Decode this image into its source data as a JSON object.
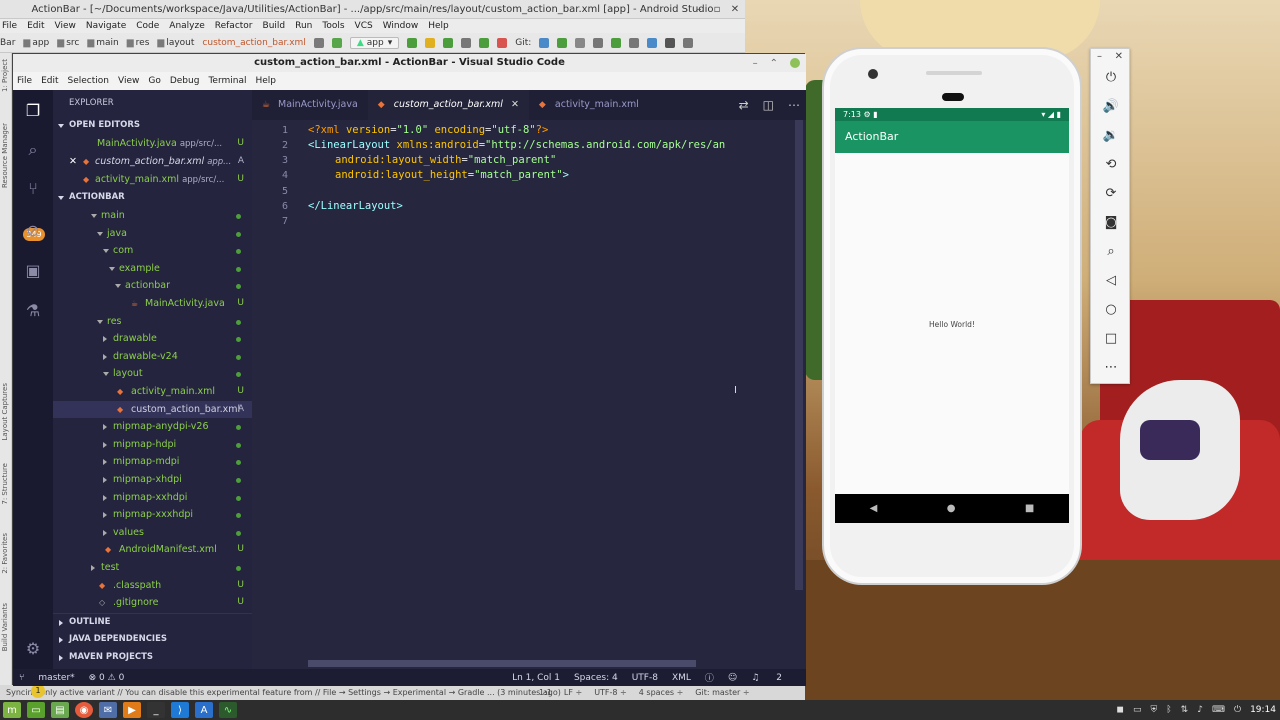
{
  "android_studio": {
    "title": "ActionBar - [~/Documents/workspace/Java/Utilities/ActionBar] - .../app/src/main/res/layout/custom_action_bar.xml [app] - Android Studio",
    "menu": [
      "File",
      "Edit",
      "View",
      "Navigate",
      "Code",
      "Analyze",
      "Refactor",
      "Build",
      "Run",
      "Tools",
      "VCS",
      "Window",
      "Help"
    ],
    "breadcrumbs": [
      "Bar",
      "app",
      "src",
      "main",
      "res",
      "layout",
      "custom_action_bar.xml"
    ],
    "run_config": "app",
    "git_label": "Git:",
    "left_tabs": [
      "1: Project",
      "Resource Manager",
      "Layout Captures",
      "7: Structure",
      "2: Favorites",
      "Build Variants"
    ],
    "status_message": "Syncing only active variant // You can disable this experimental feature from // File → Settings → Experimental → Gradle ... (3 minutes ago)",
    "status_right": [
      "1:1",
      "LF ÷",
      "UTF-8 ÷",
      "4 spaces ÷",
      "Git: master ÷"
    ]
  },
  "vscode": {
    "title": "custom_action_bar.xml - ActionBar - Visual Studio Code",
    "menu": [
      "File",
      "Edit",
      "Selection",
      "View",
      "Go",
      "Debug",
      "Terminal",
      "Help"
    ],
    "badge_scm": "349",
    "badge_settings": "1",
    "explorer_title": "EXPLORER",
    "sections": {
      "open_editors": "OPEN EDITORS",
      "actionbar": "ACTIONBAR",
      "outline": "OUTLINE",
      "java_deps": "JAVA DEPENDENCIES",
      "maven": "MAVEN PROJECTS"
    },
    "open_editors": [
      {
        "name": "MainActivity.java",
        "path": "app/src/...",
        "status": "U"
      },
      {
        "name": "custom_action_bar.xml",
        "path": "app...",
        "status": "A"
      },
      {
        "name": "activity_main.xml",
        "path": "app/src/...",
        "status": "U"
      }
    ],
    "tree": [
      {
        "label": "main",
        "status": ""
      },
      {
        "label": "java",
        "status": ""
      },
      {
        "label": "com",
        "status": ""
      },
      {
        "label": "example",
        "status": ""
      },
      {
        "label": "actionbar",
        "status": ""
      },
      {
        "label": "MainActivity.java",
        "status": "U"
      },
      {
        "label": "res",
        "status": ""
      },
      {
        "label": "drawable",
        "status": ""
      },
      {
        "label": "drawable-v24",
        "status": ""
      },
      {
        "label": "layout",
        "status": ""
      },
      {
        "label": "activity_main.xml",
        "status": "U"
      },
      {
        "label": "custom_action_bar.xml",
        "status": "A"
      },
      {
        "label": "mipmap-anydpi-v26",
        "status": ""
      },
      {
        "label": "mipmap-hdpi",
        "status": ""
      },
      {
        "label": "mipmap-mdpi",
        "status": ""
      },
      {
        "label": "mipmap-xhdpi",
        "status": ""
      },
      {
        "label": "mipmap-xxhdpi",
        "status": ""
      },
      {
        "label": "mipmap-xxxhdpi",
        "status": ""
      },
      {
        "label": "values",
        "status": ""
      },
      {
        "label": "AndroidManifest.xml",
        "status": "U"
      },
      {
        "label": "test",
        "status": ""
      },
      {
        "label": ".classpath",
        "status": "U"
      },
      {
        "label": ".gitignore",
        "status": "U"
      }
    ],
    "tabs": [
      {
        "label": "MainActivity.java"
      },
      {
        "label": "custom_action_bar.xml"
      },
      {
        "label": "activity_main.xml"
      }
    ],
    "line_numbers": [
      "1",
      "2",
      "3",
      "4",
      "5",
      "6",
      "7"
    ],
    "code": {
      "l1_decl": "<?xml ",
      "l1_a1": "version",
      "l1_v1": "\"1.0\"",
      "l1_a2": "encoding",
      "l1_v2": "\"utf-8\"",
      "l1_end": "?>",
      "l2_tag": "<LinearLayout ",
      "l2_attr": "xmlns:android",
      "l2_val": "\"http://schemas.android.com/apk/res/an",
      "l3_attr": "android:layout_width",
      "l3_val": "\"match_parent\"",
      "l4_attr": "android:layout_height",
      "l4_val": "\"match_parent\"",
      "l4_end": ">",
      "l6_tag": "</LinearLayout>"
    },
    "status": {
      "branch": "master*",
      "problems": "⊗ 0 ⚠ 0",
      "position": "Ln 1, Col 1",
      "spaces": "Spaces: 4",
      "encoding": "UTF-8",
      "language": "XML",
      "notifications": "2"
    }
  },
  "emulator": {
    "time": "7:13",
    "app_title": "ActionBar",
    "hello": "Hello World!"
  },
  "taskbar": {
    "clock": "19:14"
  },
  "colors": {
    "vscode_bg": "#26263f",
    "app_bar": "#1a9463",
    "status_bar": "#117a50"
  }
}
